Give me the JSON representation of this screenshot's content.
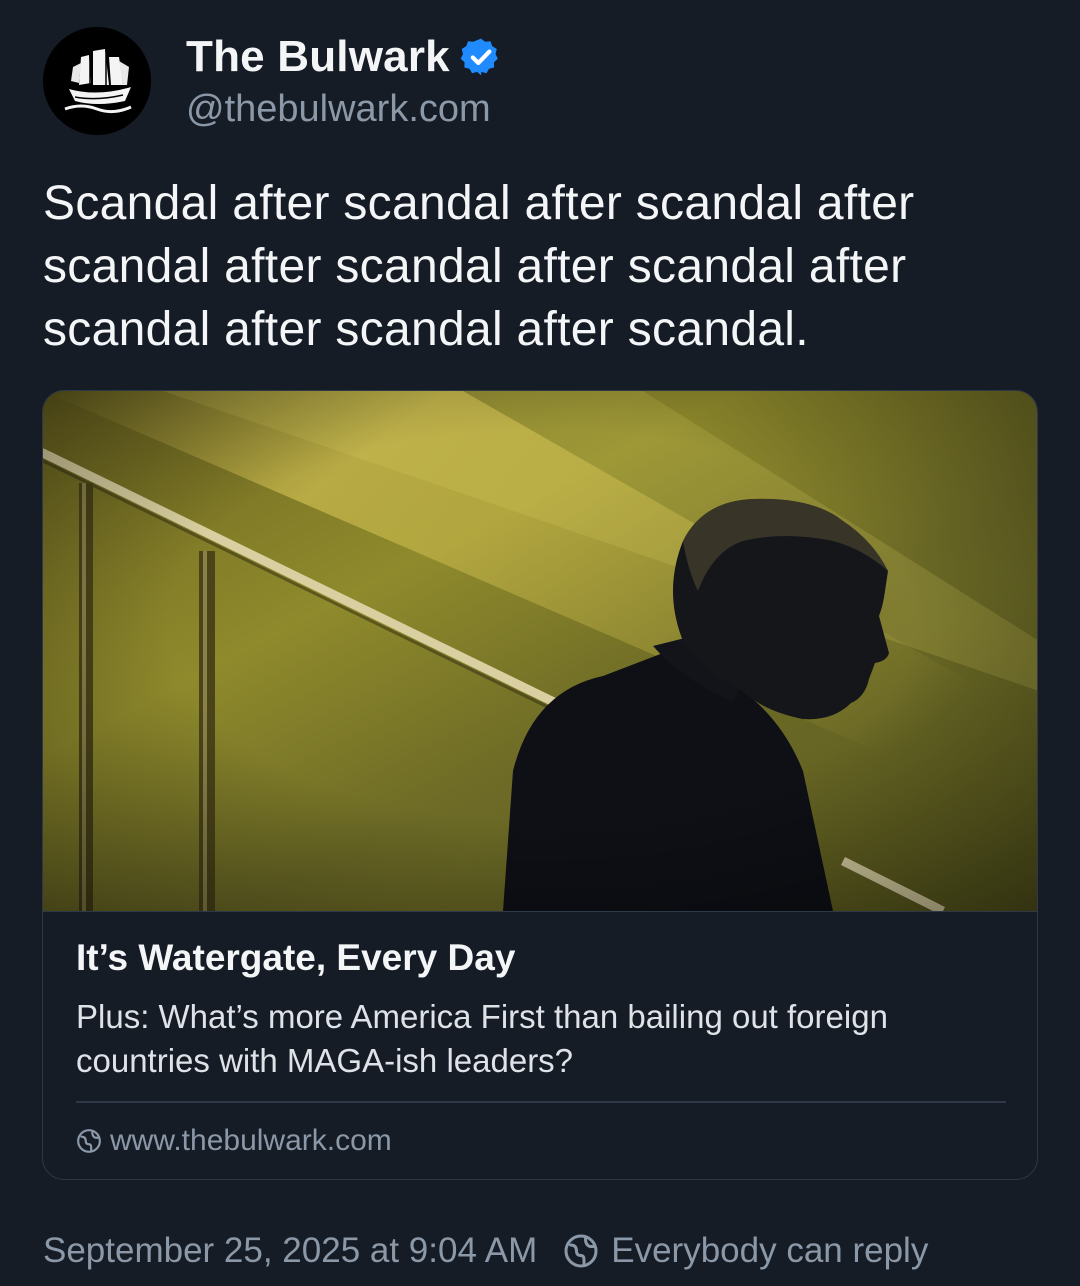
{
  "author": {
    "name": "The Bulwark",
    "handle": "@thebulwark.com",
    "verified": true,
    "avatar_icon": "ship-logo-icon",
    "badge_color": "#208bfe"
  },
  "post": {
    "text": "Scandal after scandal after scandal after scandal after scandal after scandal after scandal after scandal after scandal."
  },
  "link_card": {
    "image_icon": "silhouette-photo",
    "title": "It’s Watergate, Every Day",
    "description": "Plus: What’s more America First than bailing out foreign countries with MAGA-ish leaders?",
    "domain": "www.thebulwark.com"
  },
  "footer": {
    "timestamp": "September 25, 2025 at 9:04 AM",
    "reply_setting": "Everybody can reply"
  },
  "colors": {
    "background": "#161c26",
    "muted_text": "#8b98a8",
    "accent": "#208bfe"
  }
}
